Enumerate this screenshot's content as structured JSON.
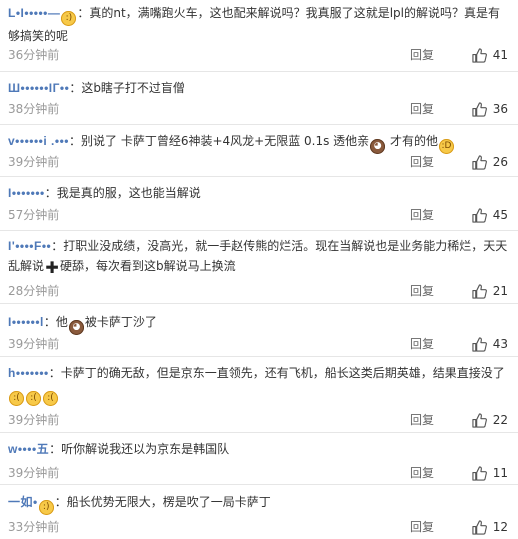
{
  "comments": [
    {
      "user": "L•I•••••—",
      "body": "：真的nt，满嘴跑火车，这也配来解说吗？我真服了这就是lpl的解说吗？真是有够搞笑的呢",
      "time": "36分钟前",
      "reply": "回复",
      "likes": "41"
    },
    {
      "user": "Ш••••••IГ••",
      "body": "：这b瞎子打不过盲僧",
      "time": "38分钟前",
      "reply": "回复",
      "likes": "36"
    },
    {
      "user": "v••••••i .•••",
      "body": "：别说了 卡萨丁曾经6神装+4风龙+无限蓝 0.1s 透他亲",
      "body_tail": " 才有的他",
      "time": "39分钟前",
      "reply": "回复",
      "likes": "26"
    },
    {
      "user": "I•••••••",
      "body": "：我是真的服，这也能当解说",
      "time": "57分钟前",
      "reply": "回复",
      "likes": "45"
    },
    {
      "user": "I'••••F••",
      "body": "：打职业没成绩，没高光，就一手赵传熊的烂活。现在当解说也是业务能力稀烂，天天乱解说",
      "body_tail": "硬舔，每次看到这b解说马上换流",
      "time": "28分钟前",
      "reply": "回复",
      "likes": "21"
    },
    {
      "user": "I••••••l",
      "body": "：他",
      "body_tail": "被卡萨丁沙了",
      "time": "39分钟前",
      "reply": "回复",
      "likes": "43"
    },
    {
      "user": "h•••••••",
      "body": "：卡萨丁的确无敌，但是京东一直领先，还有飞机，船长这类后期英雄，结果直接没了",
      "time": "39分钟前",
      "reply": "回复",
      "likes": "22"
    },
    {
      "user": "w••••五",
      "body": "：听你解说我还以为京东是韩国队",
      "time": "39分钟前",
      "reply": "回复",
      "likes": "11"
    },
    {
      "user": "一如•",
      "body": "：船长优势无限大，楞是吹了一局卡萨丁",
      "time": "33分钟前",
      "reply": "回复",
      "likes": "12"
    }
  ],
  "icons": {
    "like": "thumbs-up-icon",
    "emoji": "smiley-emoji-icon",
    "plus": "cross-emoji-icon"
  },
  "colors": {
    "username": "#4f79b8",
    "time": "#999999",
    "divider": "#e6e6e6"
  }
}
